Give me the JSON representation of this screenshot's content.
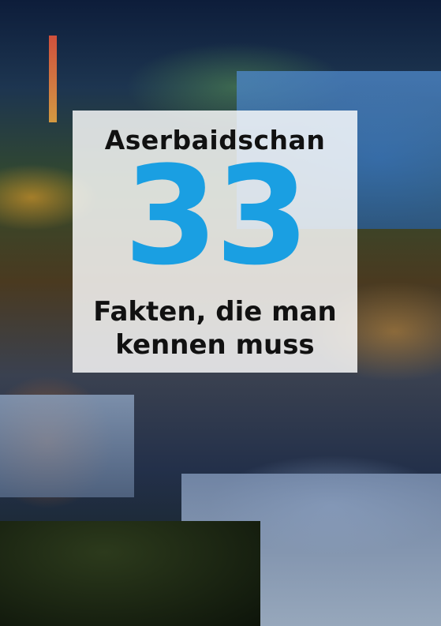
{
  "cover": {
    "title": "Aserbaidschan",
    "number": "33",
    "subtitle_line1": "Fakten, die man",
    "subtitle_line2": "kennen muss",
    "accent_color": "#1a9fe2"
  }
}
